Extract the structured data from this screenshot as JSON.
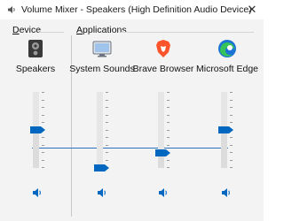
{
  "window": {
    "title": "Volume Mixer - Speakers (High Definition Audio Device)",
    "close_glyph": "✕",
    "icon": "volume-mixer-icon"
  },
  "groups": {
    "device": {
      "label_first": "D",
      "label_rest": "evice"
    },
    "applications": {
      "label_first": "A",
      "label_rest": "pplications"
    }
  },
  "channels": [
    {
      "label": "Speakers",
      "icon": "speaker-device-icon",
      "volume_percent": 50,
      "mute_icon": "speaker-icon"
    },
    {
      "label": "System Sounds",
      "icon": "system-sounds-icon",
      "volume_percent": 0,
      "mute_icon": "speaker-icon"
    },
    {
      "label": "Brave Browser",
      "icon": "brave-icon",
      "volume_percent": 20,
      "mute_icon": "speaker-icon"
    },
    {
      "label": "Microsoft Edge",
      "icon": "edge-icon",
      "volume_percent": 50,
      "mute_icon": "speaker-icon"
    }
  ],
  "colors": {
    "accent": "#0067c0",
    "brave": "#fb542b",
    "edge_blue": "#1b73d6",
    "edge_green": "#35c25a"
  }
}
